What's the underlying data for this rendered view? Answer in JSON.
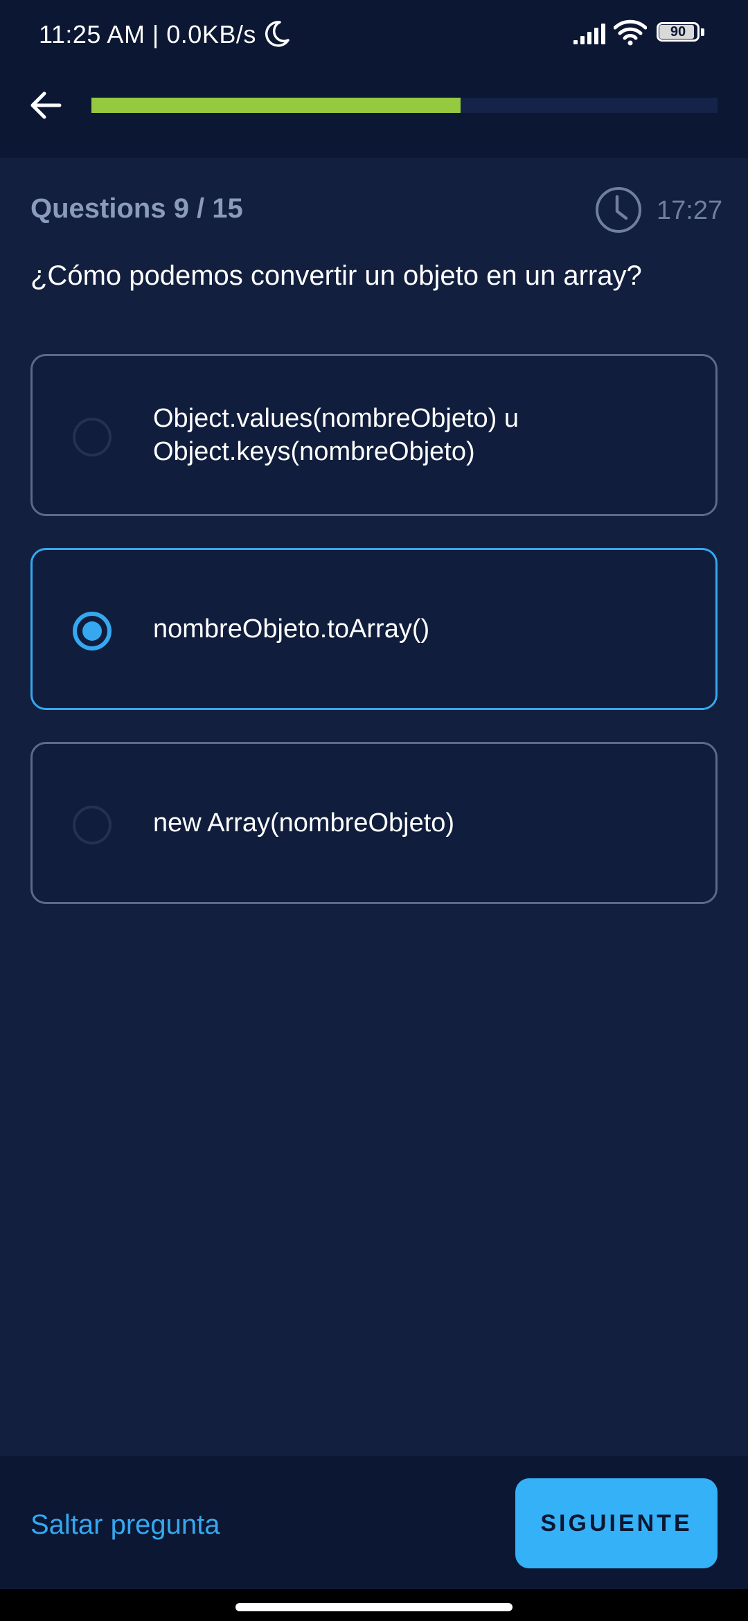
{
  "status_bar": {
    "time_text": "11:25 AM | 0.0KB/s",
    "battery_level": "90"
  },
  "header": {
    "progress": 0.59,
    "progress_color": "#95c940"
  },
  "quiz": {
    "counter": "Questions 9 / 15",
    "timer": "17:27",
    "question": "¿Cómo podemos convertir un objeto en un array?",
    "options": [
      {
        "label": "Object.values(nombreObjeto) u Object.keys(nombreObjeto)",
        "selected": false
      },
      {
        "label": "nombreObjeto.toArray()",
        "selected": true
      },
      {
        "label": "new Array(nombreObjeto)",
        "selected": false
      }
    ]
  },
  "footer": {
    "skip_label": "Saltar pregunta",
    "next_label": "SIGUIENTE"
  },
  "colors": {
    "background": "#121f3e",
    "accent": "#35a8f0"
  }
}
